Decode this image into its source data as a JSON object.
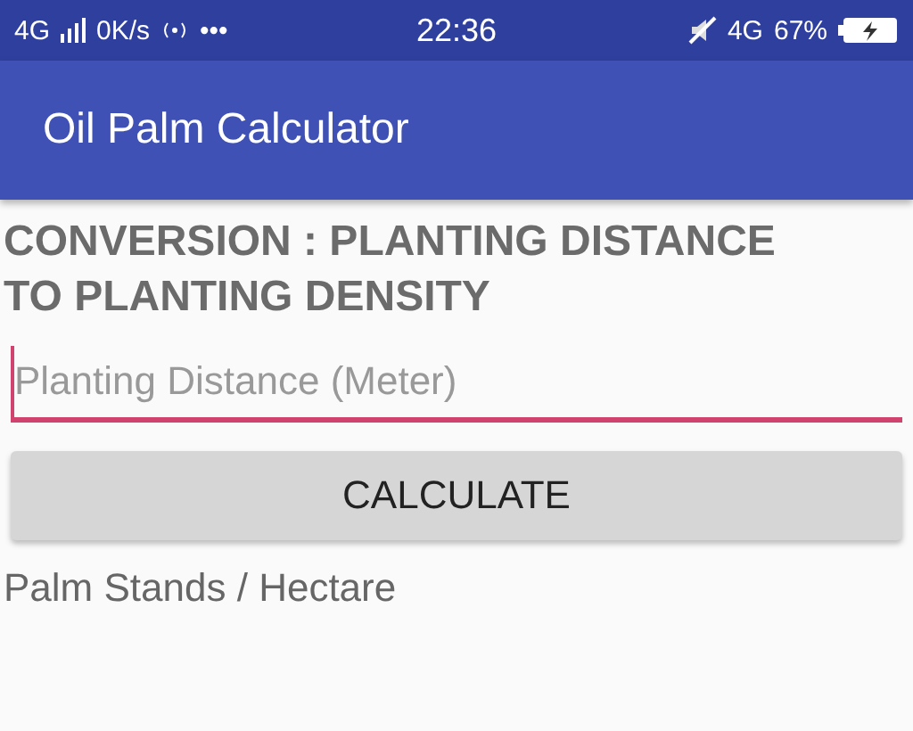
{
  "status_bar": {
    "network": "4G",
    "speed": "0K/s",
    "more": "•••",
    "time": "22:36",
    "data_type": "4G",
    "battery": "67%"
  },
  "app_bar": {
    "title": "Oil Palm Calculator"
  },
  "heading": "CONVERSION : PLANTING DISTANCE TO PLANTING DENSITY",
  "input": {
    "placeholder": "Planting Distance (Meter)",
    "focused": true
  },
  "button": "CALCULATE",
  "result_label": "Palm Stands / Hectare"
}
